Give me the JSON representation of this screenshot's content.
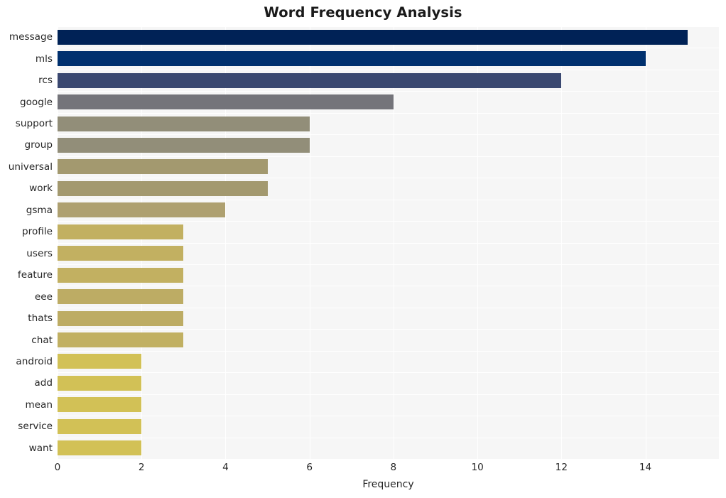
{
  "chart_data": {
    "type": "bar",
    "orientation": "horizontal",
    "title": "Word Frequency Analysis",
    "xlabel": "Frequency",
    "ylabel": "",
    "categories": [
      "message",
      "mls",
      "rcs",
      "google",
      "support",
      "group",
      "universal",
      "work",
      "gsma",
      "profile",
      "users",
      "feature",
      "eee",
      "thats",
      "chat",
      "android",
      "add",
      "mean",
      "service",
      "want"
    ],
    "values": [
      15,
      14,
      12,
      8,
      6,
      6,
      5,
      5,
      4,
      3,
      3,
      3,
      3,
      3,
      3,
      2,
      2,
      2,
      2,
      2
    ],
    "bar_colors": [
      "#002256",
      "#00306e",
      "#3a4870",
      "#74747a",
      "#928e79",
      "#928e79",
      "#a3996f",
      "#a3996f",
      "#aea070",
      "#c2b061",
      "#c2b061",
      "#c2b061",
      "#bdac64",
      "#bdac64",
      "#c1b062",
      "#d2c156",
      "#d2c156",
      "#d2c156",
      "#d2c156",
      "#d2c156"
    ],
    "xlim": [
      0,
      15.75
    ],
    "xticks": [
      0,
      2,
      4,
      6,
      8,
      10,
      12,
      14
    ],
    "xtick_labels": [
      "0",
      "2",
      "4",
      "6",
      "8",
      "10",
      "12",
      "14"
    ],
    "grid": true,
    "legend": false,
    "plot_background": "#f6f6f6",
    "figure_background": "#ffffff",
    "colormap": "cividis"
  }
}
